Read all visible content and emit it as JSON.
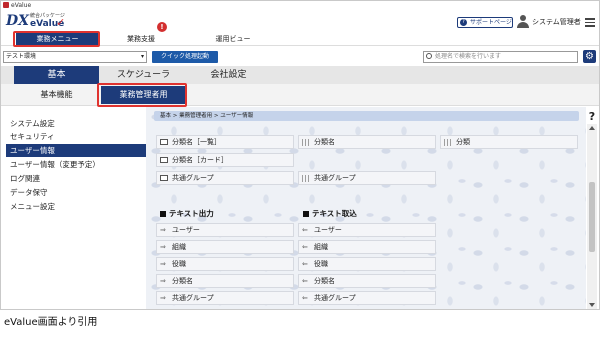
{
  "window": {
    "title": "eValue"
  },
  "logo": {
    "dx": "DX",
    "package": "統合パッケージ",
    "brand": "eValue",
    "check": "✓"
  },
  "header": {
    "support_label": "サポートページ",
    "user_name": "システム管理者"
  },
  "main_menu": {
    "items": [
      "業務メニュー",
      "業務支援",
      "運用ビュー"
    ],
    "alert": "!"
  },
  "toolbar": {
    "env_value": "テスト環境",
    "quick_button": "クイック処理起動",
    "search_placeholder": "処理名で検索を行います"
  },
  "tabs": [
    "基本",
    "スケジューラ",
    "会社設定"
  ],
  "subtabs": [
    "基本機能",
    "業務管理者用"
  ],
  "sidebar": {
    "items": [
      "システム設定",
      "セキュリティ",
      "ユーザー情報",
      "ユーザー情報（変更予定）",
      "ログ関連",
      "データ保守",
      "メニュー設定"
    ],
    "active_index": 2
  },
  "content": {
    "breadcrumb": "基本 > 業務管理者用 > ユーザー情報",
    "grid_rows": [
      [
        "分類名［一覧］",
        "分類名",
        "分類"
      ],
      [
        "分類名［カード］"
      ],
      [
        "共通グループ",
        "共通グループ"
      ]
    ],
    "sections": {
      "output_title": "テキスト出力",
      "input_title": "テキスト取込",
      "output_items": [
        "ユーザー",
        "組織",
        "役職",
        "分類名",
        "共通グループ"
      ],
      "input_items": [
        "ユーザー",
        "組織",
        "役職",
        "分類名",
        "共通グループ"
      ]
    },
    "help": "?"
  },
  "caption": "eValue画面より引用",
  "colors": {
    "navy": "#1d3b7a",
    "highlight": "#e0332f",
    "alert": "#d32f2f"
  }
}
